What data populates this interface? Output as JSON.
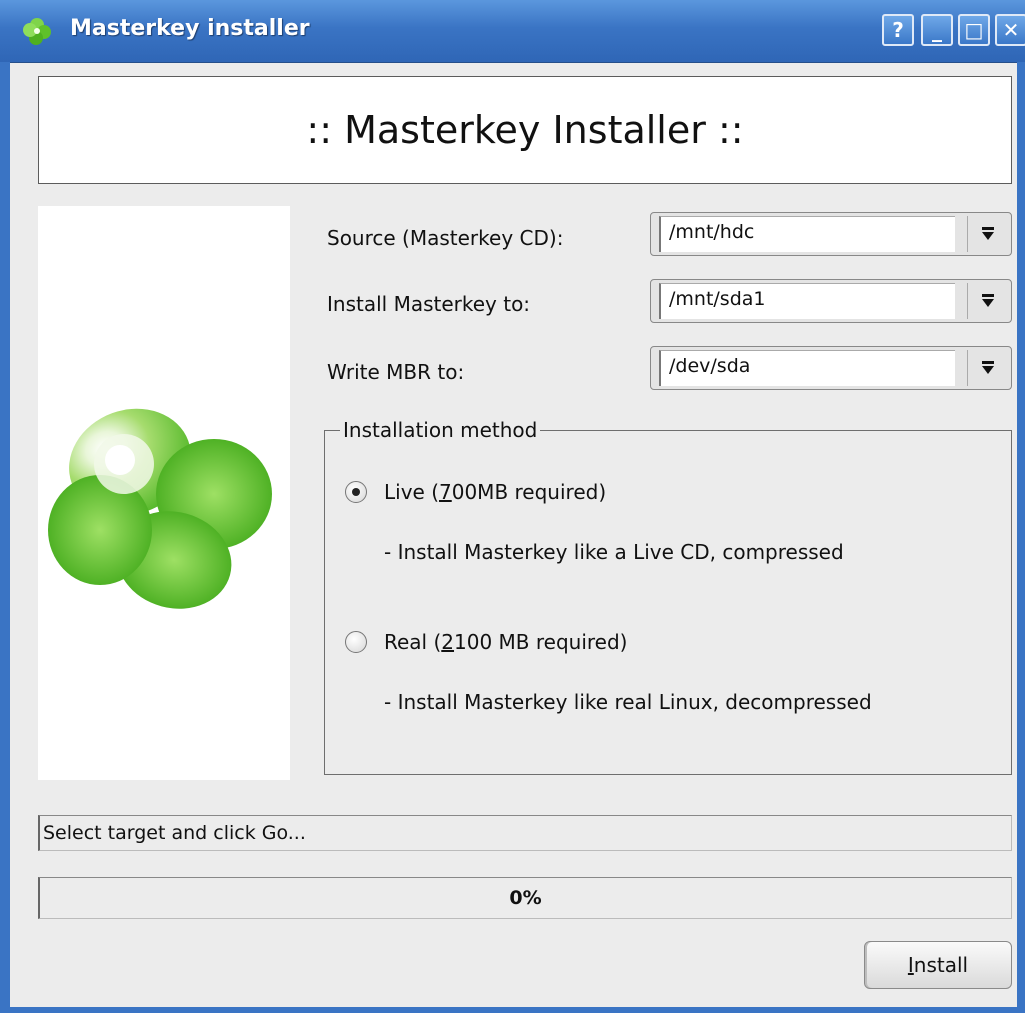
{
  "window": {
    "title": "Masterkey installer",
    "help_label": "?",
    "minimize_label": "_",
    "maximize_label": "□",
    "close_label": "✕"
  },
  "banner": {
    "text": ":: Masterkey Installer ::"
  },
  "form": {
    "source": {
      "label": "Source (Masterkey CD):",
      "value": "/mnt/hdc"
    },
    "install_to": {
      "label": "Install Masterkey to:",
      "value": "/mnt/sda1"
    },
    "mbr": {
      "label": "Write MBR to:",
      "value": "/dev/sda"
    }
  },
  "installation_method": {
    "title": "Installation method",
    "selected": "live",
    "options": [
      {
        "id": "live",
        "label_prefix": "Live (",
        "accel": "7",
        "label_suffix": "00MB required)",
        "description": "- Install Masterkey like a Live CD, compressed"
      },
      {
        "id": "real",
        "label_prefix": "Real (",
        "accel": "2",
        "label_suffix": "100 MB required)",
        "description": "- Install Masterkey like real Linux, decompressed"
      }
    ]
  },
  "status": {
    "text": "Select target and click Go..."
  },
  "progress": {
    "value": 0,
    "label": "0%"
  },
  "buttons": {
    "install_accel": "I",
    "install_rest": "nstall"
  },
  "icons": {
    "app": "clover-icon",
    "dropdown": "dropdown-arrow-icon"
  },
  "colors": {
    "titlebar": "#3a74c4",
    "clover_green": "#5fc02a",
    "progress_fill": "#6d9ad6"
  }
}
